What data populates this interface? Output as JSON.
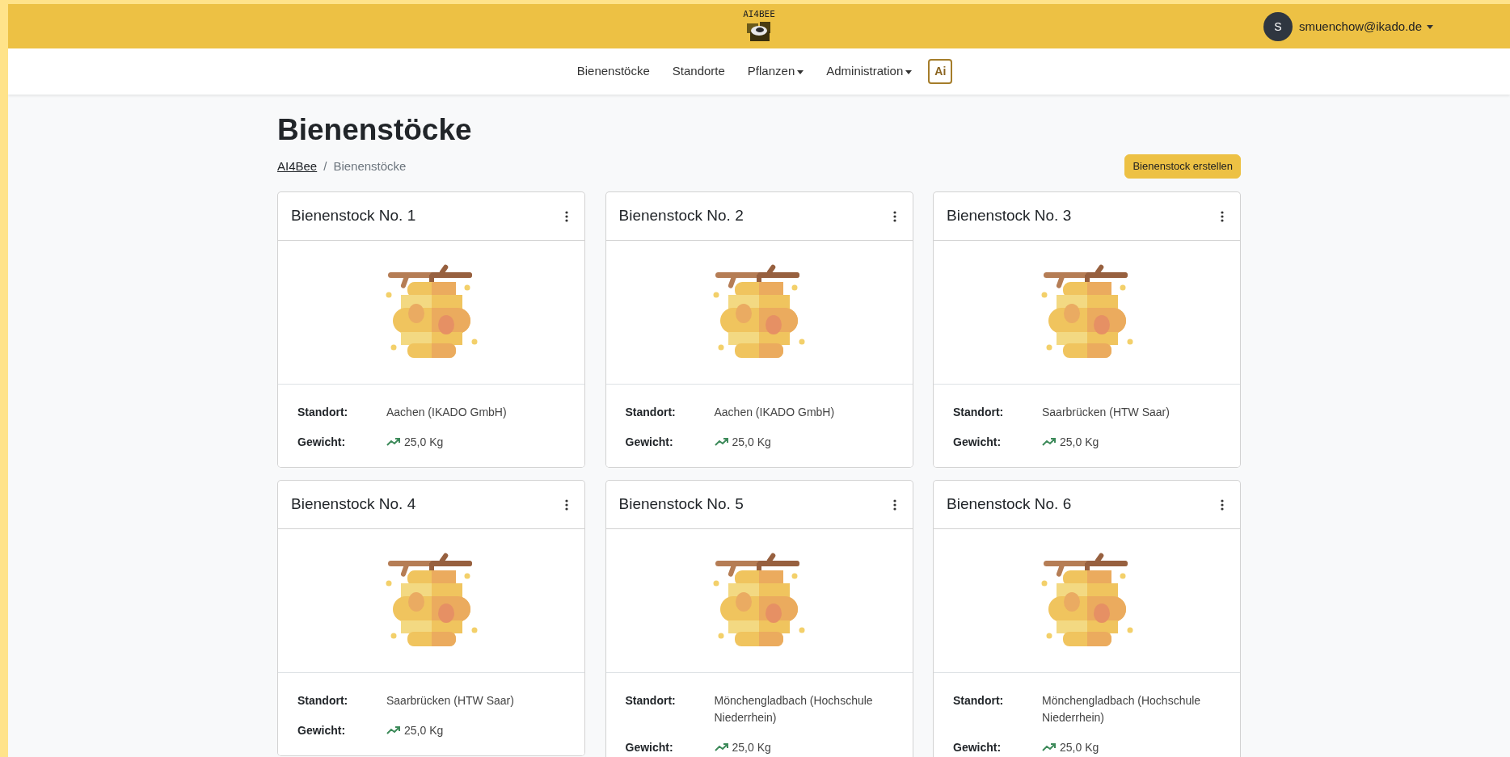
{
  "header": {
    "logo_text": "AI4BEE",
    "user": {
      "initial": "S",
      "email": "smuenchow@ikado.de"
    }
  },
  "nav": [
    {
      "label": "Bienenstöcke",
      "kind": "link"
    },
    {
      "label": "Standorte",
      "kind": "link"
    },
    {
      "label": "Pflanzen",
      "kind": "dropdown"
    },
    {
      "label": "Administration",
      "kind": "dropdown"
    },
    {
      "label": "Ai",
      "kind": "badge"
    }
  ],
  "page": {
    "title": "Bienenstöcke",
    "breadcrumb_separator": "/",
    "breadcrumb": [
      {
        "label": "AI4Bee",
        "link": true
      },
      {
        "label": "Bienenstöcke",
        "link": false
      }
    ],
    "create_button": "Bienenstock erstellen"
  },
  "hives": [
    {
      "name": "Bienenstock No. 1",
      "fields": [
        {
          "label": "Standort:",
          "value": "Aachen (IKADO GmbH)"
        },
        {
          "label": "Gewicht:",
          "value": "25,0 Kg",
          "rising": true
        }
      ]
    },
    {
      "name": "Bienenstock No. 2",
      "fields": [
        {
          "label": "Standort:",
          "value": "Aachen (IKADO GmbH)"
        },
        {
          "label": "Gewicht:",
          "value": "25,0 Kg",
          "rising": true
        }
      ]
    },
    {
      "name": "Bienenstock No. 3",
      "fields": [
        {
          "label": "Standort:",
          "value": "Saarbrücken (HTW Saar)"
        },
        {
          "label": "Gewicht:",
          "value": "25,0 Kg",
          "rising": true
        }
      ]
    },
    {
      "name": "Bienenstock No. 4",
      "fields": [
        {
          "label": "Standort:",
          "value": "Saarbrücken (HTW Saar)"
        },
        {
          "label": "Gewicht:",
          "value": "25,0 Kg",
          "rising": true
        }
      ]
    },
    {
      "name": "Bienenstock No. 5",
      "fields": [
        {
          "label": "Standort:",
          "value": "Mönchengladbach (Hochschule Niederrhein)"
        },
        {
          "label": "Gewicht:",
          "value": "25,0 Kg",
          "rising": true
        }
      ]
    },
    {
      "name": "Bienenstock No. 6",
      "fields": [
        {
          "label": "Standort:",
          "value": "Mönchengladbach (Hochschule Niederrhein)"
        },
        {
          "label": "Gewicht:",
          "value": "25,0 Kg",
          "rising": true
        }
      ]
    }
  ]
}
